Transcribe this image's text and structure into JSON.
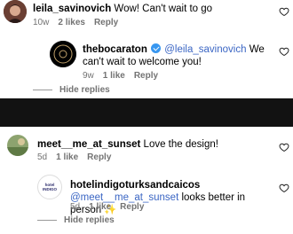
{
  "comments": [
    {
      "username": "leila_savinovich",
      "text": "Wow! Can't wait to go",
      "time": "10w",
      "likes": "2 likes",
      "reply": "Reply",
      "reply_thread": {
        "username": "thebocaraton",
        "mention": "@leila_savinovich",
        "text": "We can't wait to welcome you!",
        "time": "9w",
        "likes": "1 like",
        "reply": "Reply",
        "hide": "Hide replies"
      }
    },
    {
      "username": "meet__me_at_sunset",
      "text": "Love the design!",
      "time": "5d",
      "likes": "1 like",
      "reply": "Reply",
      "reply_thread": {
        "username": "hotelindigoturksandcaicos",
        "avatar_text": "hotel INDIGO",
        "mention": "@meet__me_at_sunset",
        "text": "looks better in person ✨",
        "time": "5d",
        "likes": "1 like",
        "reply": "Reply",
        "hide": "Hide replies"
      }
    }
  ],
  "colors": {
    "mention": "#3b66c4",
    "meta": "#737373",
    "band": "#121212"
  },
  "icons": {
    "like": "heart-outline-icon",
    "verified": "verified-badge-icon"
  }
}
